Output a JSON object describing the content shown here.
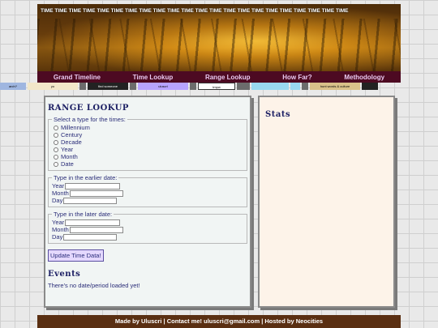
{
  "header": {
    "ticker_word": "TIME",
    "ticker_count": 22
  },
  "nav": [
    "Grand Timeline",
    "Time Lookup",
    "Range Lookup",
    "How Far?",
    "Methodology"
  ],
  "buttons": [
    "arch?",
    "yo",
    "",
    "find someone",
    "",
    "uluscri",
    "",
    "tmpw",
    "",
    "",
    "",
    "",
    "hunt words & culture",
    ""
  ],
  "range_lookup": {
    "title": "Range Lookup",
    "type_legend": "Select a type for the times:",
    "types": [
      "Millennium",
      "Century",
      "Decade",
      "Year",
      "Month",
      "Date"
    ],
    "earlier_legend": "Type in the earlier date:",
    "later_legend": "Type in the later date:",
    "fields": [
      "Year",
      "Month",
      "Day"
    ],
    "update_button": "Update Time Data!"
  },
  "events": {
    "title": "Events",
    "empty_text": "There's no date/period loaded yet!"
  },
  "stats": {
    "title": "Stats"
  },
  "footer": {
    "text": "Made by Uluscri | Contact me! uluscri@gmail.com | Hosted by Neocities"
  }
}
